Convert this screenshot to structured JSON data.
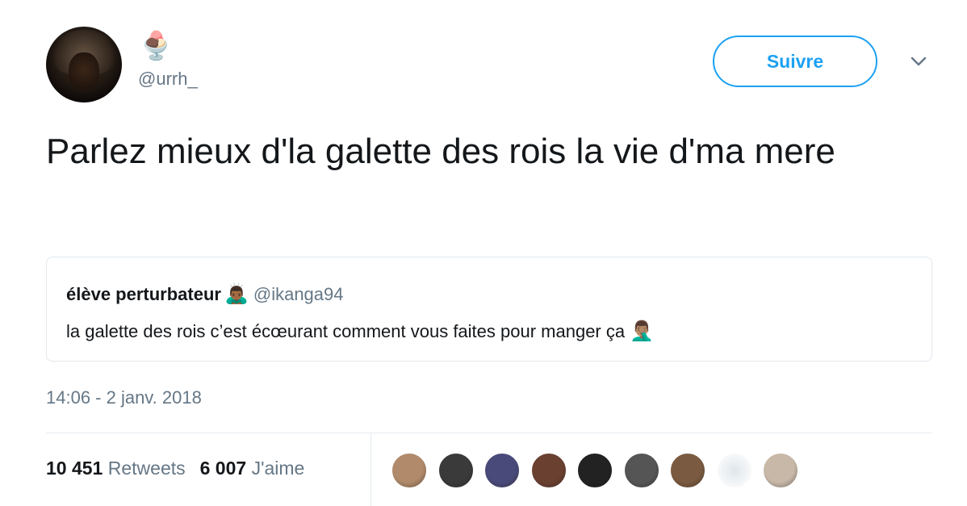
{
  "author": {
    "display_emoji": "🍨",
    "handle": "@urrh_"
  },
  "follow_label": "Suivre",
  "tweet_text": "Parlez mieux d'la galette des rois la vie d'ma mere",
  "quoted_tweet": {
    "name": "élève perturbateur",
    "name_emoji": "🙇🏾‍♂️",
    "handle": "@ikanga94",
    "text": "la galette des rois c’est écœurant comment vous faites pour manger ça",
    "text_emoji": "🤦🏽‍♂️"
  },
  "timestamp": "14:06 - 2 janv. 2018",
  "stats": {
    "retweets_count": "10 451",
    "retweets_label": "Retweets",
    "likes_count": "6 007",
    "likes_label": "J'aime"
  },
  "colors": {
    "accent": "#1da1f2",
    "secondary_text": "#657786",
    "border": "#e1e8ed"
  },
  "likers": [
    {
      "name": "liker-avatar-1",
      "color": "#b08a6a"
    },
    {
      "name": "liker-avatar-2",
      "color": "#3a3a3a"
    },
    {
      "name": "liker-avatar-3",
      "color": "#4a4a7a"
    },
    {
      "name": "liker-avatar-4",
      "color": "#6a4030"
    },
    {
      "name": "liker-avatar-5",
      "color": "#222222"
    },
    {
      "name": "liker-avatar-6",
      "color": "#555555"
    },
    {
      "name": "liker-avatar-7",
      "color": "#7a5a40"
    },
    {
      "name": "liker-avatar-8",
      "color": "#eef2f5"
    },
    {
      "name": "liker-avatar-9",
      "color": "#c8b8a8"
    }
  ]
}
